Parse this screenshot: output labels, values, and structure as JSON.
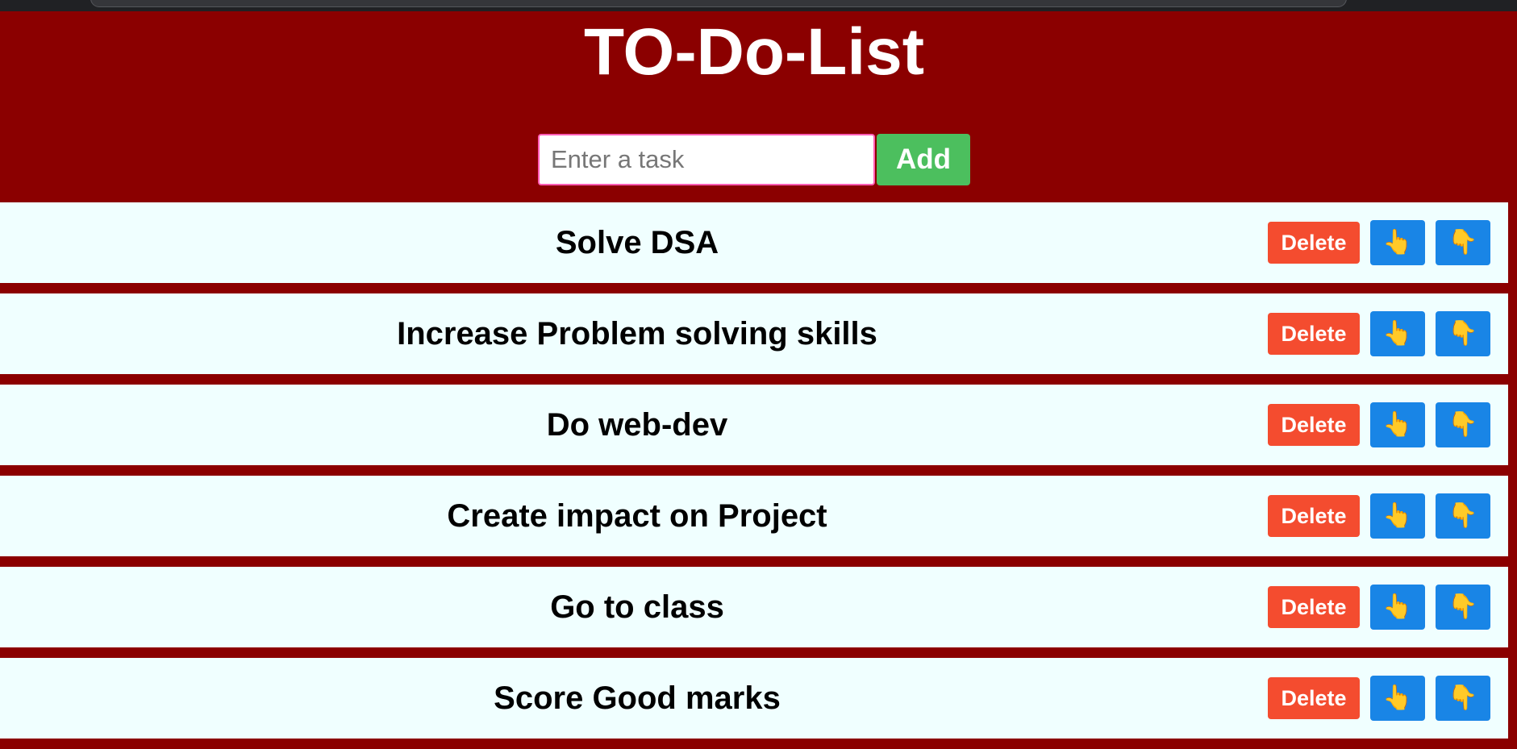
{
  "header": {
    "title": "TO-Do-List"
  },
  "form": {
    "input_value": "",
    "input_placeholder": "Enter a task",
    "add_label": "Add"
  },
  "tasks": [
    {
      "text": "Solve DSA",
      "delete_label": "Delete",
      "up_icon": "👆",
      "down_icon": "👇"
    },
    {
      "text": "Increase Problem solving skills",
      "delete_label": "Delete",
      "up_icon": "👆",
      "down_icon": "👇"
    },
    {
      "text": "Do web-dev",
      "delete_label": "Delete",
      "up_icon": "👆",
      "down_icon": "👇"
    },
    {
      "text": "Create impact on Project",
      "delete_label": "Delete",
      "up_icon": "👆",
      "down_icon": "👇"
    },
    {
      "text": "Go to class",
      "delete_label": "Delete",
      "up_icon": "👆",
      "down_icon": "👇"
    },
    {
      "text": "Score Good marks",
      "delete_label": "Delete",
      "up_icon": "👆",
      "down_icon": "👇"
    }
  ],
  "icons": {
    "move_up": "pointing-up-hand-icon",
    "move_down": "pointing-down-hand-icon"
  },
  "colors": {
    "page_background": "#8b0000",
    "row_background": "#f0ffff",
    "add_button": "#4cbf5e",
    "delete_button": "#f44c2f",
    "move_button": "#1985e6",
    "input_border": "#ff5db6"
  }
}
